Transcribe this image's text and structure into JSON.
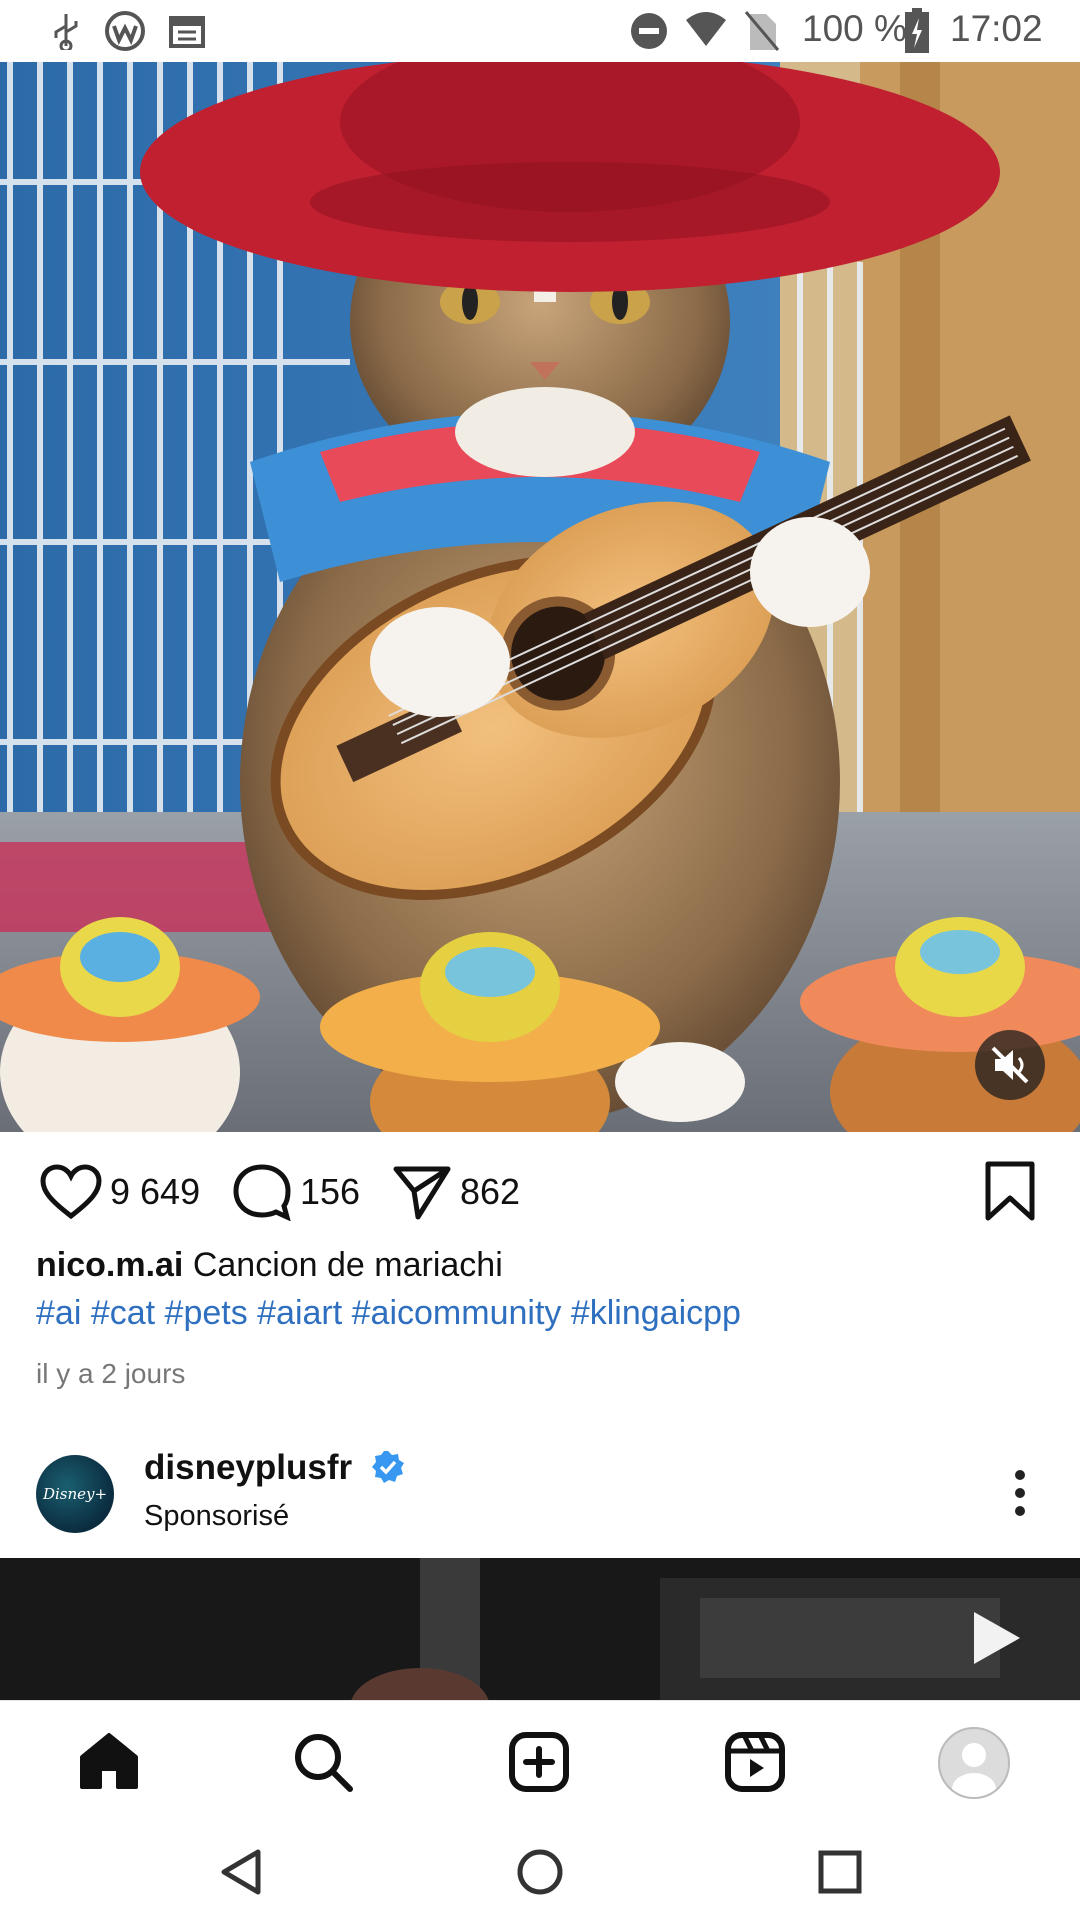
{
  "status_bar": {
    "battery": "100 %",
    "time": "17:02",
    "icons": [
      "usb-icon",
      "vpn-icon",
      "calendar-icon",
      "dnd-icon",
      "wifi-icon",
      "no-sim-icon",
      "battery-icon"
    ]
  },
  "post": {
    "likes": "9 649",
    "comments": "156",
    "shares": "862",
    "username": "nico.m.ai",
    "caption": "Cancion de mariachi",
    "hashtags": "#ai #cat #pets #aiart #aicommunity #klingaicpp",
    "timestamp": "il y a 2 jours"
  },
  "sponsored": {
    "account": "disneyplusfr",
    "label": "Sponsorisé",
    "avatar_text": "Disney+"
  },
  "bottom_nav": [
    "home-icon",
    "search-icon",
    "create-icon",
    "reels-icon",
    "profile-icon"
  ],
  "colors": {
    "hashtag": "#2f6fbf",
    "verified": "#3897f0"
  }
}
